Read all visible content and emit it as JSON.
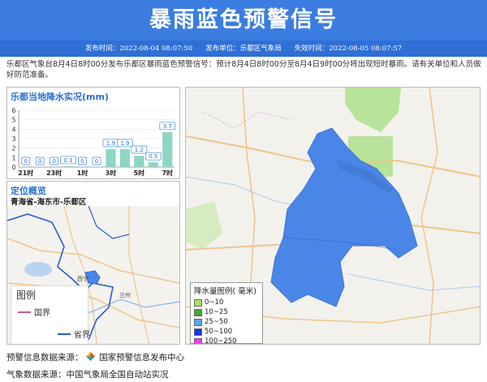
{
  "header": {
    "title": "暴雨蓝色预警信号"
  },
  "meta": {
    "publish_time": "发布时间：2022-08-04 08:07:50",
    "publisher": "发布单位：乐都区气象局",
    "expire_time": "失效时间：2022-08-05 08:07:57"
  },
  "description": "乐都区气象台8月4日8时00分发布乐都区暴雨蓝色预警信号：预计8月4日8时00分至8月4日9时00分将出现短时暴雨。请有关单位和人员做好防范准备。",
  "rain_panel": {
    "title": "乐都当地降水实况(mm)"
  },
  "chart_data": {
    "type": "bar",
    "title": "乐都当地降水实况(mm)",
    "x_tick_labels": [
      "21时",
      "23时",
      "1时",
      "3时",
      "5时",
      "7时"
    ],
    "values": [
      0,
      0,
      0,
      0.1,
      0,
      0,
      1.9,
      1.9,
      1.2,
      0.5,
      3.7
    ],
    "ylim": [
      0,
      6
    ],
    "y_ticks": [
      "0",
      "1",
      "2",
      "3",
      "4",
      "5",
      "6"
    ],
    "value_labels": [
      "0",
      "0",
      "0",
      "0.1",
      "0",
      "0",
      "1.9",
      "1.9",
      "1.2",
      "0.5",
      "3.7"
    ],
    "bar_color": "#8fd6c2",
    "value_label_color": "#3b8fd9"
  },
  "location": {
    "title": "定位概览",
    "region": "青海省-海东市-乐都区",
    "legend_title": "图例",
    "legend_items": [
      {
        "label": "国界",
        "color": "#c25b8a"
      },
      {
        "label": "省界",
        "color": "#2a5bd7"
      }
    ],
    "map_labels": {
      "xining": "西宁",
      "lanzhou": "兰州"
    }
  },
  "rain_legend": {
    "title": "降水量图例( 毫米)",
    "items": [
      {
        "label": "0~10",
        "color": "#a5e25a"
      },
      {
        "label": "10~25",
        "color": "#3fa82f"
      },
      {
        "label": "25~50",
        "color": "#5aa6ff"
      },
      {
        "label": "50~100",
        "color": "#1a2fff"
      },
      {
        "label": "100~250",
        "color": "#ff36ff"
      }
    ]
  },
  "footer": {
    "warning_source_label": "预警信息数据来源：",
    "warning_source": "国家预警信息发布中心",
    "weather_source": "气象数据来源：中国气象局全国自动站实况"
  },
  "colors": {
    "header_blue": "#3b7de0",
    "meta_blue": "#2f6fd6",
    "rain_area": "#4a86e8",
    "green_area": "#b8e39a"
  }
}
